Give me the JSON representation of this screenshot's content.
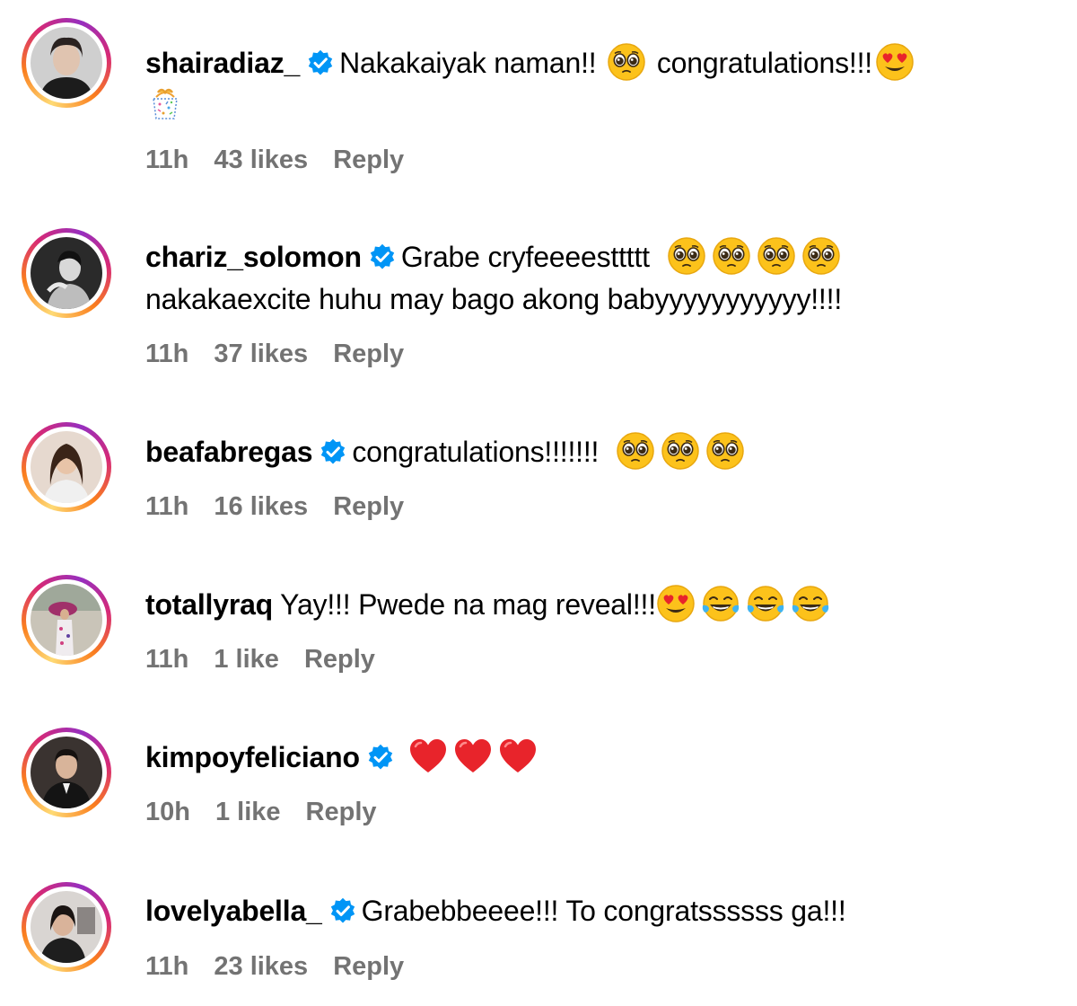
{
  "comments": [
    {
      "username": "shairadiaz_",
      "verified": true,
      "text_before": "Nakakaiyak naman!!",
      "text_after": "congratulations!!!",
      "time": "11h",
      "likes": "43 likes",
      "reply": "Reply"
    },
    {
      "username": "chariz_solomon",
      "verified": true,
      "text_line1": "Grabe cryfeeeesttttt",
      "text_line2": "nakakaexcite huhu may bago akong babyyyyyyyyyyy!!!!",
      "time": "11h",
      "likes": "37 likes",
      "reply": "Reply"
    },
    {
      "username": "beafabregas",
      "verified": true,
      "text": "congratulations!!!!!!!",
      "time": "11h",
      "likes": "16 likes",
      "reply": "Reply"
    },
    {
      "username": "totallyraq",
      "verified": false,
      "text": "Yay!!! Pwede na mag reveal!!!",
      "time": "11h",
      "likes": "1 like",
      "reply": "Reply"
    },
    {
      "username": "kimpoyfeliciano",
      "verified": true,
      "text": "",
      "time": "10h",
      "likes": "1 like",
      "reply": "Reply"
    },
    {
      "username": "lovelyabella_",
      "verified": true,
      "text": "Grabebbeeee!!! To congratssssss ga!!!",
      "time": "11h",
      "likes": "23 likes",
      "reply": "Reply"
    }
  ],
  "icons": {
    "verified_badge": "verified-badge-icon",
    "pleading_face": "pleading-face-emoji",
    "heart_eyes": "heart-eyes-emoji",
    "tears_of_joy": "tears-of-joy-emoji",
    "red_heart": "red-heart-emoji",
    "confetti": "confetti-emoji"
  },
  "colors": {
    "meta_text": "#737373",
    "verified_blue": "#0095f6",
    "text": "#000000"
  }
}
